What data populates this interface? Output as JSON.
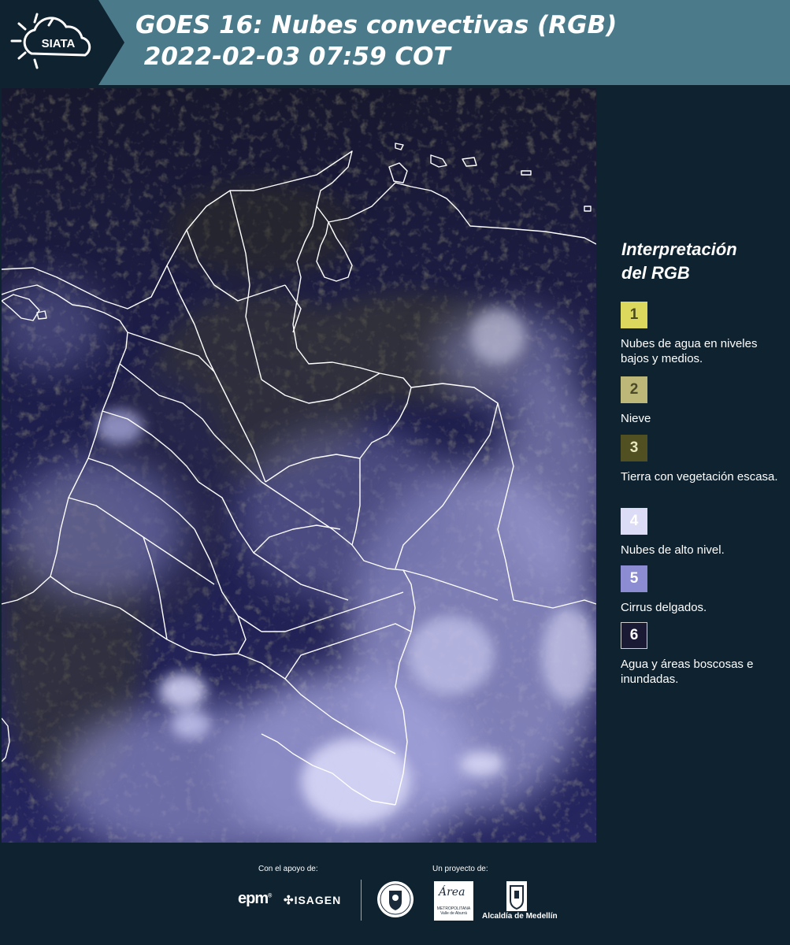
{
  "header": {
    "logo_text": "SIATA",
    "title_line1": "GOES 16: Nubes convectivas (RGB)",
    "title_line2": "2022-02-03 07:59 COT"
  },
  "legend": {
    "title_line1": "Interpretación",
    "title_line2": "del RGB",
    "items": [
      {
        "number": "1",
        "label": "Nubes de agua en niveles bajos y medios.",
        "color": "#dcd85e"
      },
      {
        "number": "2",
        "label": "Nieve",
        "color": "#bdb878"
      },
      {
        "number": "3",
        "label": "Tierra con vegetación escasa.",
        "color": "#505022"
      },
      {
        "number": "4",
        "label": "Nubes de alto nivel.",
        "color": "#dcdcf6"
      },
      {
        "number": "5",
        "label": "Cirrus delgados.",
        "color": "#8c8cd2"
      },
      {
        "number": "6",
        "label": "Agua y áreas boscosas e inundadas.",
        "color": "#1a1a34"
      }
    ]
  },
  "footer": {
    "support_label": "Con el apoyo de:",
    "project_label": "Un proyecto de:",
    "sponsor1": "epm",
    "sponsor2": "ISAGEN",
    "partner_area": "Área",
    "partner_area_sub": "METROPOLITANA Valle de Aburrá",
    "partner_alcaldia": "Alcaldía de Medellín"
  }
}
